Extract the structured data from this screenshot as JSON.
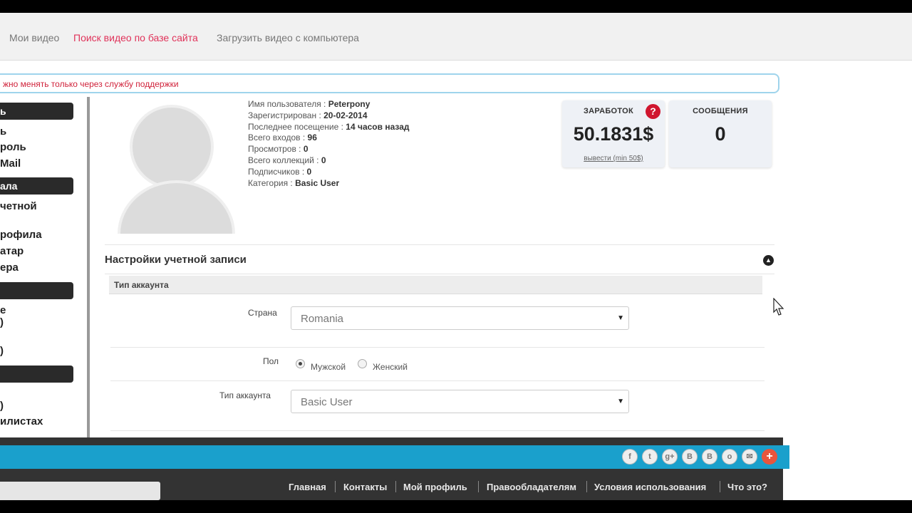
{
  "topnav": {
    "items": [
      {
        "label": "Мои видео",
        "active": false
      },
      {
        "label": "Поиск видео по базе сайта",
        "active": true
      },
      {
        "label": "Загрузить видео с компьютера",
        "active": false
      }
    ]
  },
  "notice": {
    "text": "жно менять только через службу поддержки"
  },
  "sidebar": {
    "groups": [
      {
        "title": "ь",
        "items": [
          "ь",
          "роль",
          "Mail"
        ]
      },
      {
        "title": "ала",
        "items": [
          "четной",
          "рофила",
          "атар",
          "ера"
        ]
      },
      {
        "title": "",
        "items": [
          "е",
          ")",
          ")"
        ]
      },
      {
        "title": "",
        "items": [
          ")",
          "илистах"
        ]
      }
    ]
  },
  "profile": {
    "username_label": "Имя пользователя :",
    "username": "Peterpony",
    "registered_label": "Зарегистрирован :",
    "registered": "20-02-2014",
    "last_visit_label": "Последнее посещение :",
    "last_visit": "14 часов назад",
    "logins_label": "Всего входов :",
    "logins": "96",
    "views_label": "Просмотров :",
    "views": "0",
    "collections_label": "Всего коллекций :",
    "collections": "0",
    "subscribers_label": "Подписчиков :",
    "subscribers": "0",
    "category_label": "Категория :",
    "category": "Basic User"
  },
  "earnings": {
    "label": "ЗАРАБОТОК",
    "amount": "50.1831$",
    "withdraw": "вывести (min 50$)",
    "help_icon": "question-icon"
  },
  "messages": {
    "label": "СООБЩЕНИЯ",
    "count": "0"
  },
  "settings": {
    "title": "Настройки учетной записи",
    "subheader": "Тип аккаунта",
    "country_label": "Страна",
    "country_value": "Romania",
    "gender_label": "Пол",
    "gender_options": [
      {
        "label": "Мужской",
        "checked": true
      },
      {
        "label": "Женский",
        "checked": false
      }
    ],
    "account_type_label": "Тип аккаунта",
    "account_type_value": "Basic User"
  },
  "social_icons": [
    "facebook-icon",
    "twitter-icon",
    "google-plus-icon",
    "vk-icon",
    "blogger-icon",
    "odnoklassniki-icon",
    "email-icon",
    "more-icon"
  ],
  "footer": {
    "links": [
      "Главная",
      "Контакты",
      "Мой профиль",
      "Правообладателям",
      "Условия использования",
      "Что это?"
    ]
  },
  "colors": {
    "accent_link": "#e0335a",
    "notice_border": "#9fd4ec",
    "share_bar": "#1aa0cc",
    "help_badge": "#d0162f"
  }
}
